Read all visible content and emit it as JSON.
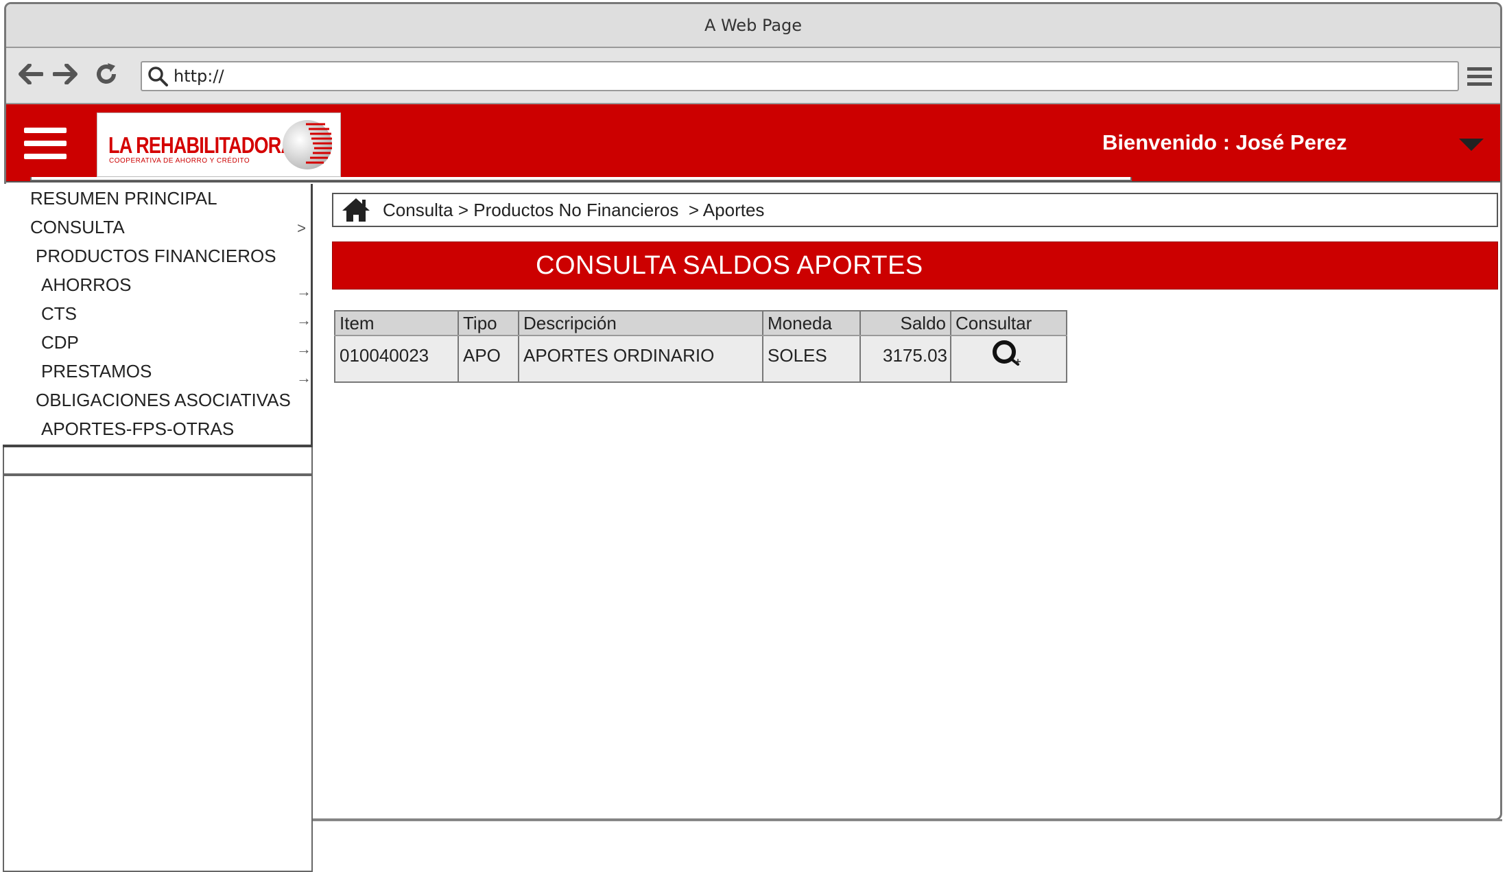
{
  "browser": {
    "window_title": "A Web Page",
    "url": "http://"
  },
  "header": {
    "logo_text": "LA REHABILITADORA",
    "logo_tagline": "COOPERATIVA DE AHORRO Y CRÉDITO",
    "welcome_text": "Bienvenido : José Perez",
    "accent_color": "#cc0000"
  },
  "sidebar": {
    "items": [
      {
        "label": "RESUMEN PRINCIPAL"
      },
      {
        "label": "CONSULTA",
        "arrow": ">"
      },
      {
        "label": "PRODUCTOS FINANCIEROS"
      },
      {
        "label": "AHORROS",
        "arrow": "→"
      },
      {
        "label": "CTS",
        "arrow": "→"
      },
      {
        "label": "CDP",
        "arrow": "→"
      },
      {
        "label": "PRESTAMOS",
        "arrow": "→"
      },
      {
        "label": "OBLIGACIONES ASOCIATIVAS"
      },
      {
        "label": "APORTES-FPS-OTRAS"
      }
    ]
  },
  "breadcrumb": {
    "path": "Consulta > Productos No Financieros  > Aportes"
  },
  "page": {
    "title": "CONSULTA SALDOS APORTES"
  },
  "table": {
    "headers": [
      "Item",
      "Tipo",
      "Descripción",
      "Moneda",
      "Saldo",
      "Consultar"
    ],
    "rows": [
      {
        "item": "010040023",
        "tipo": "APO",
        "descripcion": "APORTES ORDINARIO",
        "moneda": "SOLES",
        "saldo": "3175.03"
      }
    ]
  }
}
